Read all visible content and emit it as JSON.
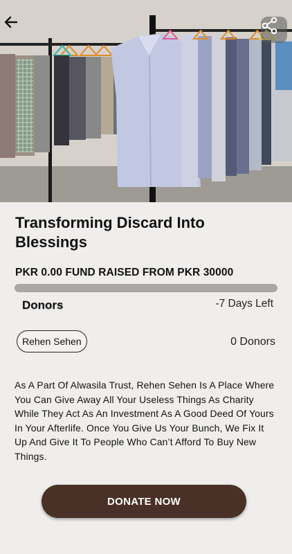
{
  "header": {
    "back_icon": "arrow-left-icon",
    "share_icon": "share-icon"
  },
  "campaign": {
    "title": "Transforming Discard Into Blessings",
    "fund_line": "PKR 0.00 FUND RAISED FROM PKR 30000",
    "progress_fraction": 0.0,
    "donors_heading": "Donors",
    "days_left": "-7 Days Left",
    "tag": "Rehen Sehen",
    "donor_count": "0 Donors",
    "description": "As A Part Of Alwasila Trust, Rehen Sehen Is A Place Where You Can Give Away All Your Useless Things As Charity While They Act As An Investment As A Good Deed Of Yours In Your Afterlife. Once You Give Us Your Bunch, We Fix It Up And Give It To People Who Can’t Afford To Buy New Things."
  },
  "actions": {
    "donate_label": "DONATE NOW"
  },
  "colors": {
    "background": "#f0eeec",
    "accent_brown": "#4a3127",
    "progress_track": "#a9a7a5"
  }
}
